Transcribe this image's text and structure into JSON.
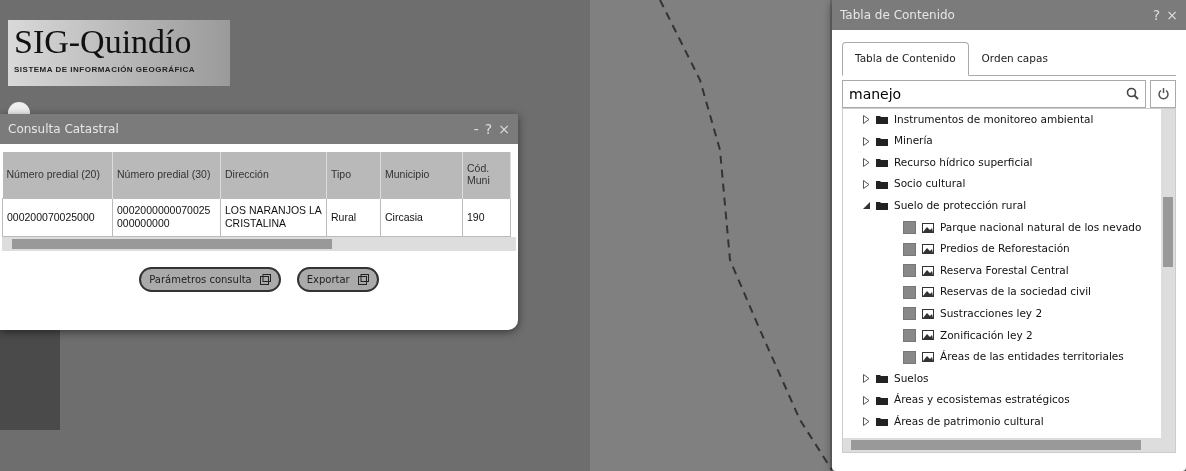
{
  "logo": {
    "title": "SIG-Quindío",
    "subtitle": "SISTEMA DE INFORMACIÓN GEOGRÁFICA"
  },
  "query_window": {
    "title": "Consulta Catastral",
    "controls": [
      "-",
      "?",
      "×"
    ],
    "table": {
      "columns": [
        "Número predial (20)",
        "Número predial (30)",
        "Dirección",
        "Tipo",
        "Municipio",
        "Cód. Muni"
      ],
      "rows": [
        [
          "000200070025000",
          "0002000000070025 000000000",
          "LOS NARANJOS LA CRISTALINA",
          "Rural",
          "Circasia",
          "190"
        ]
      ]
    },
    "buttons": [
      "Parámetros consulta",
      "Exportar"
    ]
  },
  "toc_window": {
    "title": "Tabla de Contenido",
    "controls": [
      "?",
      "×"
    ],
    "tabs": [
      {
        "label": "Tabla de Contenido",
        "selected": true
      },
      {
        "label": "Orden capas",
        "selected": false
      }
    ],
    "search": {
      "value": "manejo"
    },
    "tree": [
      {
        "label": "Instrumentos de monitoreo ambiental",
        "expanded": false
      },
      {
        "label": "Minería",
        "expanded": false
      },
      {
        "label": "Recurso hídrico superficial",
        "expanded": false
      },
      {
        "label": "Socio cultural",
        "expanded": false
      },
      {
        "label": "Suelo de protección rural",
        "expanded": true,
        "children": [
          {
            "label": "Parque nacional natural de los nevado",
            "checked": true
          },
          {
            "label": "Predios de Reforestación",
            "checked": true
          },
          {
            "label": "Reserva Forestal Central",
            "checked": true
          },
          {
            "label": "Reservas de la sociedad civil",
            "checked": true
          },
          {
            "label": "Sustracciones ley 2",
            "checked": true
          },
          {
            "label": "Zonificación ley 2",
            "checked": true
          },
          {
            "label": "Áreas de las entidades territoriales",
            "checked": true
          }
        ]
      },
      {
        "label": "Suelos",
        "expanded": false
      },
      {
        "label": "Áreas y ecosistemas estratégicos",
        "expanded": false
      },
      {
        "label": "Áreas de patrimonio cultural",
        "expanded": false
      }
    ]
  }
}
